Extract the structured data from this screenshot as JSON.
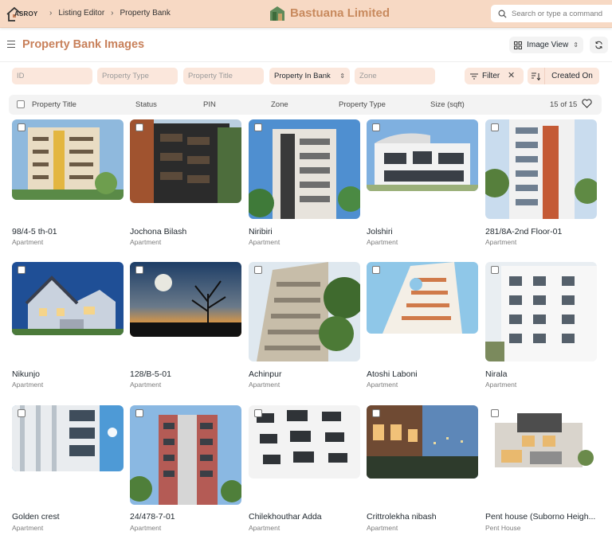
{
  "app": {
    "logo_text": "ASROY",
    "breadcrumbs": [
      "Listing Editor",
      "Property Bank"
    ],
    "brand": "Bastuana Limited",
    "search_placeholder": "Search or type a command"
  },
  "page": {
    "title": "Property Bank Images",
    "view_label": "Image View"
  },
  "filters": {
    "id_placeholder": "ID",
    "type_placeholder": "Property Type",
    "title_placeholder": "Property Title",
    "in_bank_label": "Property In Bank",
    "zone_placeholder": "Zone",
    "filter_label": "Filter",
    "sort_label": "Created On"
  },
  "columns": [
    "Property Title",
    "Status",
    "PIN",
    "Zone",
    "Property Type",
    "Size (sqft)"
  ],
  "count_text": "15 of 15",
  "cards": [
    {
      "title": "98/4-5 th-01",
      "type": "Apartment",
      "img": "tower-yellow"
    },
    {
      "title": "Jochona Bilash",
      "type": "Apartment",
      "img": "tower-dark"
    },
    {
      "title": "Niribiri",
      "type": "Apartment",
      "img": "tower-modern"
    },
    {
      "title": "Jolshiri",
      "type": "Apartment",
      "img": "villa-white"
    },
    {
      "title": "281/8A-2nd Floor-01",
      "type": "Apartment",
      "img": "tower-brick"
    },
    {
      "title": "Nikunjo",
      "type": "Apartment",
      "img": "house-night"
    },
    {
      "title": "128/B-5-01",
      "type": "Apartment",
      "img": "moon-tree"
    },
    {
      "title": "Achinpur",
      "type": "Apartment",
      "img": "tower-beige"
    },
    {
      "title": "Atoshi Laboni",
      "type": "Apartment",
      "img": "tower-curve"
    },
    {
      "title": "Nirala",
      "type": "Apartment",
      "img": "tower-white"
    },
    {
      "title": "Golden crest",
      "type": "Apartment",
      "img": "facade-blue"
    },
    {
      "title": "24/478-7-01",
      "type": "Apartment",
      "img": "tower-red"
    },
    {
      "title": "Chilekhouthar Adda",
      "type": "Apartment",
      "img": "facade-balcony"
    },
    {
      "title": "Crittrolekha nibash",
      "type": "Apartment",
      "img": "terrace-dusk"
    },
    {
      "title": "Pent house (Suborno Heigh...",
      "type": "Pent House",
      "img": "house-modern"
    }
  ],
  "colors": {
    "navbar": "#f7d9c4",
    "accent": "#c8805a",
    "field_bg": "#fbe7dc"
  }
}
